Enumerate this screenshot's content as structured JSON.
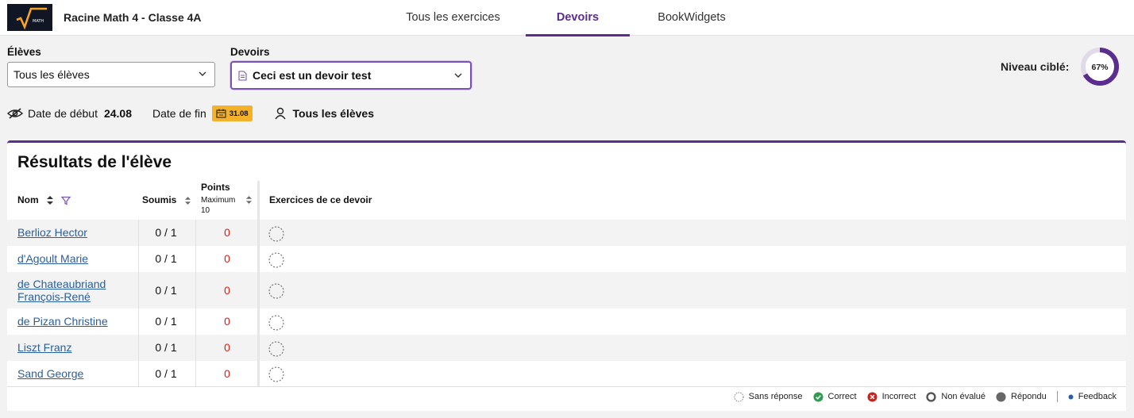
{
  "header": {
    "logo_text": "MATH",
    "app_title": "Racine Math 4 - Classe 4A",
    "tabs": [
      {
        "label": "Tous les exercices"
      },
      {
        "label": "Devoirs"
      },
      {
        "label": "BookWidgets"
      }
    ],
    "active_tab": "Devoirs"
  },
  "filters": {
    "students_label": "Élèves",
    "students_value": "Tous les élèves",
    "assignments_label": "Devoirs",
    "assignments_value": "Ceci est un devoir test"
  },
  "target_level": {
    "label": "Niveau ciblé:",
    "value_text": "67%",
    "value": 0.67,
    "color": "#5b2d8e"
  },
  "info_bar": {
    "start_label": "Date de début",
    "start_value": "24.08",
    "end_label": "Date de fin",
    "end_value": "31.08",
    "students": "Tous les élèves"
  },
  "results": {
    "title": "Résultats de l'élève",
    "columns": {
      "name": "Nom",
      "submitted": "Soumis",
      "points": "Points",
      "points_max_label": "Maximum",
      "points_max_value": "10",
      "exercises": "Exercices de ce devoir"
    },
    "rows": [
      {
        "name_line1": "Berlioz Hector",
        "name_line2": "",
        "submitted": "0 / 1",
        "points": "0",
        "status": "Sans réponse"
      },
      {
        "name_line1": "d'Agoult Marie",
        "name_line2": "",
        "submitted": "0 / 1",
        "points": "0",
        "status": "Sans réponse"
      },
      {
        "name_line1": "de Chateaubriand",
        "name_line2": "François-René",
        "submitted": "0 / 1",
        "points": "0",
        "status": "Sans réponse"
      },
      {
        "name_line1": "de Pizan Christine",
        "name_line2": "",
        "submitted": "0 / 1",
        "points": "0",
        "status": "Sans réponse"
      },
      {
        "name_line1": "Liszt Franz",
        "name_line2": "",
        "submitted": "0 / 1",
        "points": "0",
        "status": "Sans réponse"
      },
      {
        "name_line1": "Sand George",
        "name_line2": "",
        "submitted": "0 / 1",
        "points": "0",
        "status": "Sans réponse"
      }
    ]
  },
  "legend": [
    {
      "label": "Sans réponse",
      "icon": "dashed-circle-icon"
    },
    {
      "label": "Correct",
      "icon": "check-circle-icon",
      "color": "#2e9e4f"
    },
    {
      "label": "Incorrect",
      "icon": "x-circle-icon",
      "color": "#d0201a"
    },
    {
      "label": "Non évalué",
      "icon": "ring-circle-icon",
      "color": "#555555"
    },
    {
      "label": "Répondu",
      "icon": "filled-circle-icon",
      "color": "#666666"
    },
    {
      "label": "Feedback",
      "icon": "dot-icon",
      "color": "#2a5f9e"
    }
  ]
}
